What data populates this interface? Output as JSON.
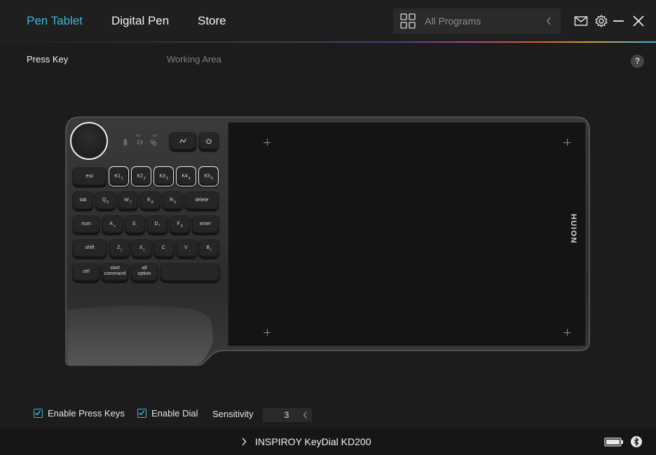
{
  "tabs": [
    {
      "label": "Pen Tablet",
      "active": true
    },
    {
      "label": "Digital Pen",
      "active": false
    },
    {
      "label": "Store",
      "active": false
    }
  ],
  "programs": {
    "label": "All Programs"
  },
  "icons": {
    "programs": "grid-icon",
    "collapse": "chevron-left-icon",
    "mail": "mail-icon",
    "settings": "gear-icon",
    "minimize": "minimize-icon",
    "close": "close-icon",
    "help": "help-icon",
    "battery": "battery-icon",
    "bluetooth": "bluetooth-icon"
  },
  "subtabs": [
    {
      "label": "Press Key",
      "active": true
    },
    {
      "label": "Working Area",
      "active": false
    }
  ],
  "help": {
    "label": "?"
  },
  "device": {
    "brand": "HUION",
    "keys": {
      "row1": [
        {
          "main": "esc",
          "sub": ""
        },
        {
          "main": "K1",
          "sub": "1"
        },
        {
          "main": "K2",
          "sub": "2"
        },
        {
          "main": "K3",
          "sub": "3"
        },
        {
          "main": "K4",
          "sub": "4"
        },
        {
          "main": "K5",
          "sub": "5"
        }
      ],
      "row2": [
        {
          "main": "tab",
          "sub": ""
        },
        {
          "main": "Q",
          "sub": "6"
        },
        {
          "main": "W",
          "sub": "7"
        },
        {
          "main": "E",
          "sub": "8"
        },
        {
          "main": "R",
          "sub": "9"
        },
        {
          "main": "delete",
          "sub": ""
        }
      ],
      "row3": [
        {
          "main": "num",
          "sub": ""
        },
        {
          "main": "A",
          "sub": "+"
        },
        {
          "main": "S",
          "sub": "-"
        },
        {
          "main": "D",
          "sub": "*"
        },
        {
          "main": "F",
          "sub": "0"
        },
        {
          "main": "enter",
          "sub": ""
        }
      ],
      "row4": [
        {
          "main": "shift",
          "sub": ""
        },
        {
          "main": "Z",
          "sub": "("
        },
        {
          "main": "X",
          "sub": ")"
        },
        {
          "main": "C",
          "sub": ","
        },
        {
          "main": "V",
          "sub": "."
        },
        {
          "main": "B",
          "sub": "/"
        }
      ],
      "row5": [
        {
          "main": "ctrl",
          "sub": ""
        },
        {
          "main": "start",
          "sub": "command"
        },
        {
          "main": "alt",
          "sub": "option"
        },
        {
          "main": "",
          "sub": ""
        }
      ]
    }
  },
  "controls": {
    "enable_press_keys": {
      "label": "Enable Press Keys",
      "checked": true
    },
    "enable_dial": {
      "label": "Enable Dial",
      "checked": true
    },
    "sensitivity": {
      "label": "Sensitivity",
      "value": "3"
    }
  },
  "status": {
    "device_name": "INSPIROY KeyDial KD200"
  },
  "colors": {
    "accent": "#3fb6d6",
    "background": "#1c1c1c"
  }
}
